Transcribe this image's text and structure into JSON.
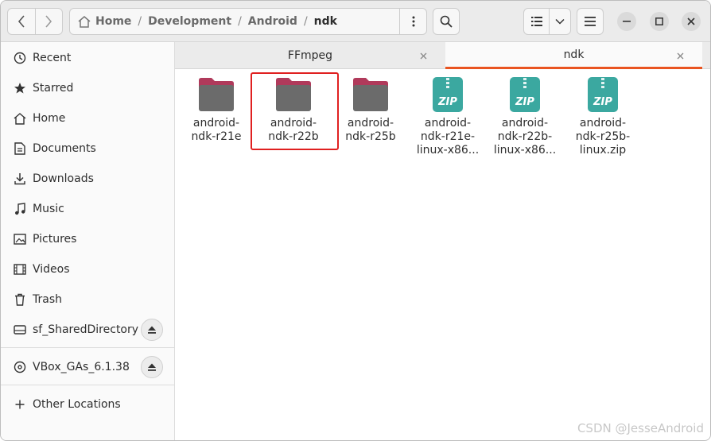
{
  "pathbar": {
    "crumbs": [
      "Home",
      "Development",
      "Android",
      "ndk"
    ],
    "separator": "/"
  },
  "sidebar": {
    "items": [
      {
        "label": "Recent",
        "icon": "clock-icon"
      },
      {
        "label": "Starred",
        "icon": "star-icon"
      },
      {
        "label": "Home",
        "icon": "home-icon"
      },
      {
        "label": "Documents",
        "icon": "document-icon"
      },
      {
        "label": "Downloads",
        "icon": "download-icon"
      },
      {
        "label": "Music",
        "icon": "music-icon"
      },
      {
        "label": "Pictures",
        "icon": "picture-icon"
      },
      {
        "label": "Videos",
        "icon": "video-icon"
      },
      {
        "label": "Trash",
        "icon": "trash-icon"
      }
    ],
    "mounts": [
      {
        "label": "sf_SharedDirectory",
        "icon": "drive-icon",
        "eject_icon": "eject-icon"
      },
      {
        "label": "VBox_GAs_6.1.38",
        "icon": "disc-icon",
        "eject_icon": "eject-icon"
      }
    ],
    "other": {
      "label": "Other Locations",
      "icon": "plus-icon"
    }
  },
  "tabs": [
    {
      "label": "FFmpeg",
      "active": false
    },
    {
      "label": "ndk",
      "active": true
    }
  ],
  "files": [
    {
      "type": "folder",
      "lines": [
        "android-",
        "ndk-r21e"
      ]
    },
    {
      "type": "folder",
      "lines": [
        "android-",
        "ndk-r22b"
      ],
      "highlighted": true
    },
    {
      "type": "folder",
      "lines": [
        "android-",
        "ndk-r25b"
      ]
    },
    {
      "type": "zip",
      "lines": [
        "android-",
        "ndk-r21e-",
        "linux-x86..."
      ]
    },
    {
      "type": "zip",
      "lines": [
        "android-",
        "ndk-r22b-",
        "linux-x86..."
      ]
    },
    {
      "type": "zip",
      "lines": [
        "android-",
        "ndk-r25b-",
        "linux.zip"
      ]
    }
  ],
  "zip_badge": "ZIP",
  "watermark": "CSDN @JesseAndroid",
  "colors": {
    "accent": "#e95420",
    "folder_top": "#b03a5b",
    "folder_body": "#6b6b6b",
    "zip": "#3ba8a0",
    "highlight": "#e02020"
  }
}
